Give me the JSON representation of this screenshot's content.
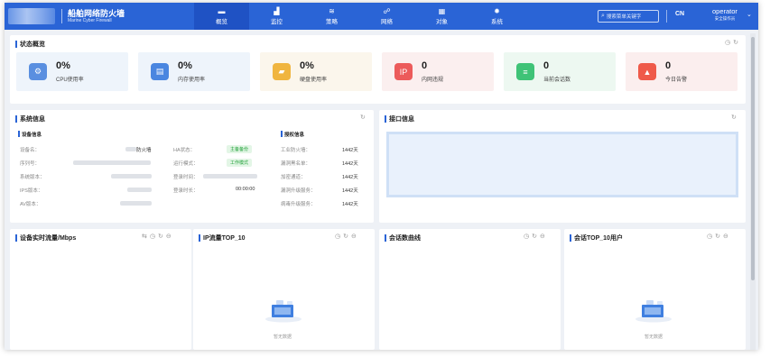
{
  "header": {
    "brand_cn": "船舶网络防火墙",
    "brand_en": "Marine Cyber Firewall",
    "nav": [
      {
        "label": "概览",
        "icon": "▬",
        "icon_name": "overview-icon",
        "active": true
      },
      {
        "label": "监控",
        "icon": "▟",
        "icon_name": "monitor-icon"
      },
      {
        "label": "策略",
        "icon": "≋",
        "icon_name": "policy-icon"
      },
      {
        "label": "网络",
        "icon": "☍",
        "icon_name": "network-icon"
      },
      {
        "label": "对象",
        "icon": "▦",
        "icon_name": "object-icon"
      },
      {
        "label": "系统",
        "icon": "✹",
        "icon_name": "system-icon"
      }
    ],
    "search_placeholder": "搜索菜单关键字",
    "lang": "CN",
    "user_name": "operator",
    "user_role": "安全操作员"
  },
  "status": {
    "title": "状态概览",
    "cards": [
      {
        "value": "0%",
        "label": "CPU使用率",
        "bg": "#eef4fb",
        "icon_bg": "#5a8fe0",
        "icon": "⚙"
      },
      {
        "value": "0%",
        "label": "内存使用率",
        "bg": "#eef4fb",
        "icon_bg": "#4a86e0",
        "icon": "▤"
      },
      {
        "value": "0%",
        "label": "硬盘使用率",
        "bg": "#fbf6ec",
        "icon_bg": "#f0b53f",
        "icon": "▰"
      },
      {
        "value": "0",
        "label": "内网违规",
        "bg": "#fbefef",
        "icon_bg": "#ec5b5b",
        "icon": "IP"
      },
      {
        "value": "0",
        "label": "当前会话数",
        "bg": "#edf8f1",
        "icon_bg": "#3fc377",
        "icon": "≡"
      },
      {
        "value": "0",
        "label": "今日告警",
        "bg": "#fbeeee",
        "icon_bg": "#ef5a4a",
        "icon": "▲"
      }
    ]
  },
  "sysinfo": {
    "title": "系统信息",
    "device_title": "设备信息",
    "license_title": "授权信息",
    "col1": [
      {
        "label": "设备名：",
        "value": "防火墙"
      },
      {
        "label": "序列号：",
        "value": ""
      },
      {
        "label": "系统版本：",
        "value": ""
      },
      {
        "label": "IPS版本：",
        "value": ""
      },
      {
        "label": "AV版本：",
        "value": ""
      }
    ],
    "col2": [
      {
        "label": "HA状态：",
        "value": "主备备份"
      },
      {
        "label": "运行模式：",
        "value": "工作模式"
      },
      {
        "label": "登录时间：",
        "value": ""
      },
      {
        "label": "登录时长：",
        "value": "00:00:00"
      }
    ],
    "col3": [
      {
        "label": "工业防火墙：",
        "value": "1442天"
      },
      {
        "label": "漏洞黑名单：",
        "value": "1442天"
      },
      {
        "label": "加密通道：",
        "value": "1442天"
      },
      {
        "label": "漏洞升级服务：",
        "value": "1442天"
      },
      {
        "label": "病毒升级服务：",
        "value": "1442天"
      }
    ]
  },
  "iface": {
    "title": "接口信息"
  },
  "bottom": [
    {
      "title": "设备实时流量/Mbps",
      "empty": ""
    },
    {
      "title": "IP流量TOP_10",
      "empty": "暂无数据"
    },
    {
      "title": "会话数曲线",
      "empty": ""
    },
    {
      "title": "会话TOP_10用户",
      "empty": "暂无数据"
    }
  ]
}
